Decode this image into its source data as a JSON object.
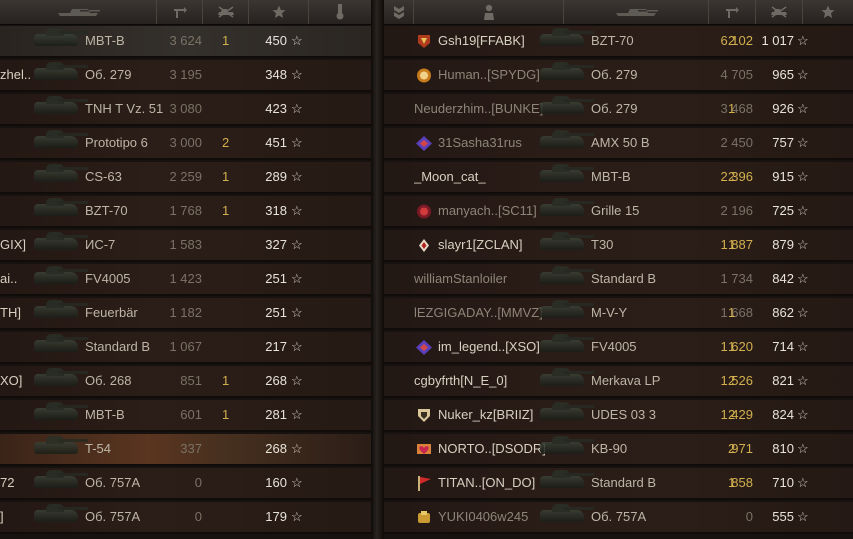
{
  "left_team": {
    "rows": [
      {
        "player": "",
        "vehicle": "MBT-B",
        "damage": "3 624",
        "kills": "1",
        "points": "450",
        "highlight": "top"
      },
      {
        "player": "zhel..",
        "vehicle": "Об. 279",
        "damage": "3 195",
        "kills": "",
        "points": "348"
      },
      {
        "player": "",
        "vehicle": "TNH T Vz. 51",
        "damage": "3 080",
        "kills": "",
        "points": "423"
      },
      {
        "player": "",
        "vehicle": "Prototipo 6",
        "damage": "3 000",
        "kills": "2",
        "points": "451"
      },
      {
        "player": "",
        "vehicle": "CS-63",
        "damage": "2 259",
        "kills": "1",
        "points": "289"
      },
      {
        "player": "",
        "vehicle": "BZT-70",
        "damage": "1 768",
        "kills": "1",
        "points": "318"
      },
      {
        "player": "GIX]",
        "vehicle": "ИС-7",
        "damage": "1 583",
        "kills": "",
        "points": "327"
      },
      {
        "player": "ai..",
        "vehicle": "FV4005",
        "damage": "1 423",
        "kills": "",
        "points": "251"
      },
      {
        "player": "TH]",
        "vehicle": "Feuerbär",
        "damage": "1 182",
        "kills": "",
        "points": "251"
      },
      {
        "player": "",
        "vehicle": "Standard B",
        "damage": "1 067",
        "kills": "",
        "points": "217"
      },
      {
        "player": "XO]",
        "vehicle": "Об. 268",
        "damage": "851",
        "kills": "1",
        "points": "268"
      },
      {
        "player": "",
        "vehicle": "MBT-B",
        "damage": "601",
        "kills": "1",
        "points": "281"
      },
      {
        "player": "",
        "vehicle": "T-54",
        "damage": "337",
        "kills": "",
        "points": "268",
        "highlight": "hl"
      },
      {
        "player": "72",
        "vehicle": "Об. 757A",
        "damage": "0",
        "kills": "",
        "points": "160"
      },
      {
        "player": "]",
        "vehicle": "Об. 757A",
        "damage": "0",
        "kills": "",
        "points": "179"
      }
    ]
  },
  "right_team": {
    "rows": [
      {
        "player": "Gsh19[FFABK]",
        "badge": "clan-red",
        "vehicle": "BZT-70",
        "damage": "6 102",
        "kills": "2",
        "points": "1 017",
        "bright": true
      },
      {
        "player": "Human..[SPYDG]",
        "badge": "clan-orange",
        "vehicle": "Об. 279",
        "damage": "4 705",
        "kills": "",
        "points": "965",
        "bright": false
      },
      {
        "player": "Neuderzhim..[BUNKE]",
        "badge": "",
        "vehicle": "Об. 279",
        "damage": "3 468",
        "kills": "1",
        "points": "926",
        "bright": false
      },
      {
        "player": "31Sasha31rus",
        "badge": "clan-purple",
        "vehicle": "AMX 50 B",
        "damage": "2 450",
        "kills": "",
        "points": "757",
        "bright": false
      },
      {
        "player": "_Moon_cat_",
        "badge": "",
        "vehicle": "MBT-B",
        "damage": "2 396",
        "kills": "2",
        "points": "915",
        "bright": true
      },
      {
        "player": "manyach..[SC11]",
        "badge": "clan-crimson",
        "vehicle": "Grille 15",
        "damage": "2 196",
        "kills": "",
        "points": "725",
        "bright": false
      },
      {
        "player": "slayr1[ZCLAN]",
        "badge": "clan-diamond",
        "vehicle": "T30",
        "damage": "1 887",
        "kills": "1",
        "points": "879",
        "bright": true
      },
      {
        "player": "williamStanloiler",
        "badge": "",
        "vehicle": "Standard B",
        "damage": "1 734",
        "kills": "",
        "points": "842",
        "bright": false
      },
      {
        "player": "lEZGIGADAY..[MMVZ]",
        "badge": "",
        "vehicle": "M-V-Y",
        "damage": "1 668",
        "kills": "1",
        "points": "862",
        "bright": false
      },
      {
        "player": "im_legend..[XSO]",
        "badge": "clan-purple",
        "vehicle": "FV4005",
        "damage": "1 620",
        "kills": "1",
        "points": "714",
        "bright": true
      },
      {
        "player": "cgbyfrth[N_E_0]",
        "badge": "",
        "vehicle": "Merkava LP",
        "damage": "1 526",
        "kills": "2",
        "points": "821",
        "bright": true
      },
      {
        "player": "Nuker_kz[BRIIZ]",
        "badge": "clan-shield",
        "vehicle": "UDES 03 3",
        "damage": "1 429",
        "kills": "2",
        "points": "824",
        "bright": true
      },
      {
        "player": "NORTO..[DSODR]",
        "badge": "clan-love",
        "vehicle": "KB-90",
        "damage": "971",
        "kills": "2",
        "points": "810",
        "bright": true
      },
      {
        "player": "TITAN..[ON_DO]",
        "badge": "clan-flag",
        "vehicle": "Standard B",
        "damage": "858",
        "kills": "1",
        "points": "710",
        "bright": true
      },
      {
        "player": "YUKI0406w245",
        "badge": "clan-gold",
        "vehicle": "Об. 757A",
        "damage": "0",
        "kills": "",
        "points": "555",
        "bright": false
      }
    ]
  },
  "header_icons": [
    "vehicle-icon",
    "damage-icon",
    "kills-icon",
    "points-star-icon",
    "medal-icon",
    "rank-chevron-icon",
    "player-icon"
  ],
  "star_glyph": "☆",
  "colors": {
    "gold": "#d2b04f",
    "text": "#cfc7b6",
    "dim": "#7a7266"
  }
}
